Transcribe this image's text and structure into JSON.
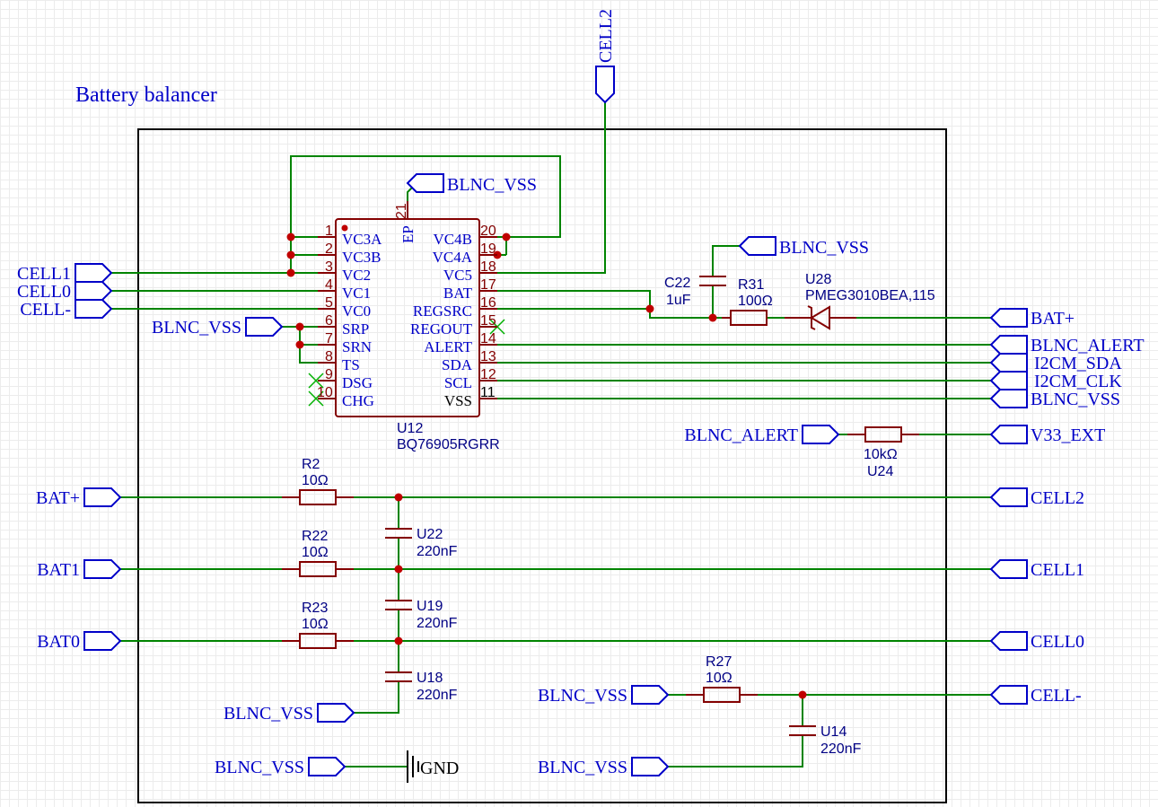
{
  "title": "Battery balancer",
  "ic": {
    "ref": "U12",
    "value": "BQ76905RGRR",
    "ep_name": "EP",
    "ep_num": "21",
    "left_pins": [
      {
        "num": "1",
        "name": "VC3A"
      },
      {
        "num": "2",
        "name": "VC3B"
      },
      {
        "num": "3",
        "name": "VC2"
      },
      {
        "num": "4",
        "name": "VC1"
      },
      {
        "num": "5",
        "name": "VC0"
      },
      {
        "num": "6",
        "name": "SRP"
      },
      {
        "num": "7",
        "name": "SRN"
      },
      {
        "num": "8",
        "name": "TS"
      },
      {
        "num": "9",
        "name": "DSG"
      },
      {
        "num": "10",
        "name": "CHG"
      }
    ],
    "right_pins": [
      {
        "num": "20",
        "name": "VC4B"
      },
      {
        "num": "19",
        "name": "VC4A"
      },
      {
        "num": "18",
        "name": "VC5"
      },
      {
        "num": "17",
        "name": "BAT"
      },
      {
        "num": "16",
        "name": "REGSRC"
      },
      {
        "num": "15",
        "name": "REGOUT"
      },
      {
        "num": "14",
        "name": "ALERT"
      },
      {
        "num": "13",
        "name": "SDA"
      },
      {
        "num": "12",
        "name": "SCL"
      },
      {
        "num": "11",
        "name": "VSS"
      }
    ]
  },
  "components": {
    "c22": {
      "ref": "C22",
      "value": "1uF"
    },
    "r31": {
      "ref": "R31",
      "value": "100Ω"
    },
    "u28": {
      "ref": "U28",
      "value": "PMEG3010BEA,115"
    },
    "u24": {
      "ref": "U24",
      "value": "10kΩ"
    },
    "r2": {
      "ref": "R2",
      "value": "10Ω"
    },
    "r22": {
      "ref": "R22",
      "value": "10Ω"
    },
    "r23": {
      "ref": "R23",
      "value": "10Ω"
    },
    "r27": {
      "ref": "R27",
      "value": "10Ω"
    },
    "u22": {
      "ref": "U22",
      "value": "220nF"
    },
    "u19": {
      "ref": "U19",
      "value": "220nF"
    },
    "u18": {
      "ref": "U18",
      "value": "220nF"
    },
    "u14": {
      "ref": "U14",
      "value": "220nF"
    },
    "gnd": {
      "label": "GND"
    }
  },
  "nets": {
    "cell2_top": "CELL2",
    "blnc_vss_ep": "BLNC_VSS",
    "blnc_vss_c22": "BLNC_VSS",
    "cell1_in": "CELL1",
    "cell0_in": "CELL0",
    "cellm_in": "CELL-",
    "blnc_vss_srp": "BLNC_VSS",
    "bat_plus_out": "BAT+",
    "blnc_alert_out": "BLNC_ALERT",
    "i2cm_sda": "I2CM_SDA",
    "i2cm_clk": "I2CM_CLK",
    "blnc_vss_out": "BLNC_VSS",
    "blnc_alert_in": "BLNC_ALERT",
    "v33_ext": "V33_EXT",
    "bat_plus_in": "BAT+",
    "bat1_in": "BAT1",
    "bat0_in": "BAT0",
    "cell2_out": "CELL2",
    "cell1_out": "CELL1",
    "cell0_out": "CELL0",
    "blnc_vss_u18": "BLNC_VSS",
    "blnc_vss_gnd": "BLNC_VSS",
    "blnc_vss_r27": "BLNC_VSS",
    "cellm_out": "CELL-",
    "blnc_vss_u14": "BLNC_VSS"
  }
}
